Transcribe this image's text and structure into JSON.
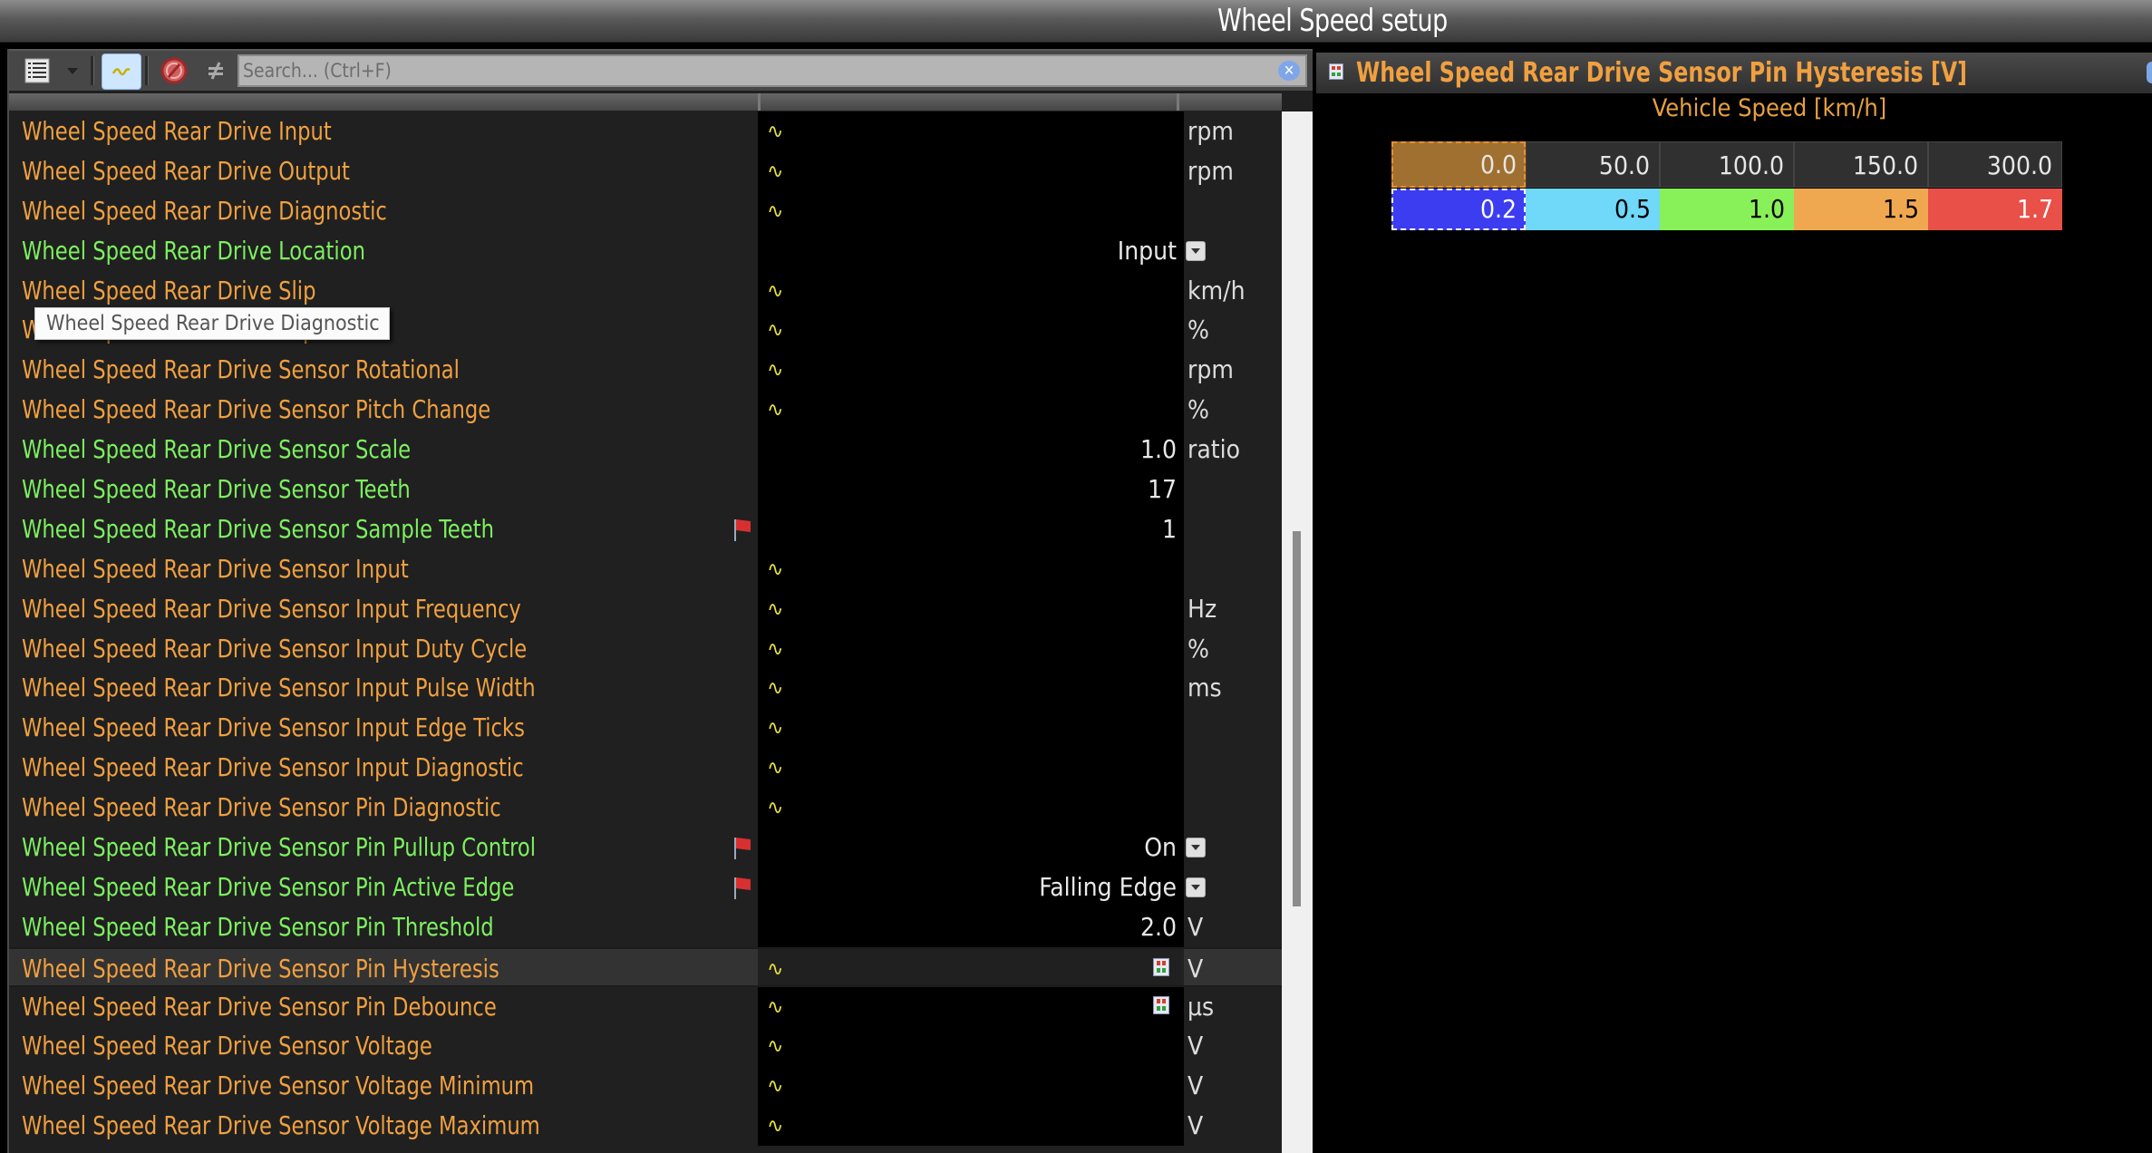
{
  "window": {
    "title": "Wheel Speed setup"
  },
  "toolbar": {
    "view_menu_icon": "list-view-icon",
    "view_dropdown_icon": "chevron-down-icon",
    "live_toggle_icon": "sine-wave-icon",
    "stop_icon": "prohibited-icon",
    "not_equal_icon": "not-equal-icon",
    "search_placeholder": "Search... (Ctrl+F)",
    "search_value": "",
    "clear_icon": "clear-search-icon"
  },
  "tooltip": {
    "text": "Wheel Speed Rear Drive Diagnostic"
  },
  "colors": {
    "output_channel": "#f0a040",
    "setting": "#7df060",
    "live_icon": "#e8e040"
  },
  "channels": [
    {
      "name": "Wheel Speed Rear Drive Input",
      "kind": "output",
      "live": true,
      "value": "",
      "unit": "rpm"
    },
    {
      "name": "Wheel Speed Rear Drive Output",
      "kind": "output",
      "live": true,
      "value": "",
      "unit": "rpm"
    },
    {
      "name": "Wheel Speed Rear Drive Diagnostic",
      "kind": "output",
      "live": true,
      "value": "",
      "unit": ""
    },
    {
      "name": "Wheel Speed Rear Drive Location",
      "kind": "setting",
      "live": false,
      "value": "Input",
      "dropdown": true,
      "unit": ""
    },
    {
      "name": "Wheel Speed Rear Drive Slip",
      "kind": "output",
      "live": true,
      "value": "",
      "unit": "km/h"
    },
    {
      "name": "Wheel Speed Rear Drive Slip Ratio",
      "kind": "output",
      "live": true,
      "value": "",
      "unit": "%"
    },
    {
      "name": "Wheel Speed Rear Drive Sensor Rotational",
      "kind": "output",
      "live": true,
      "value": "",
      "unit": "rpm"
    },
    {
      "name": "Wheel Speed Rear Drive Sensor Pitch Change",
      "kind": "output",
      "live": true,
      "value": "",
      "unit": "%"
    },
    {
      "name": "Wheel Speed Rear Drive Sensor Scale",
      "kind": "setting",
      "live": false,
      "value": "1.0",
      "unit": "ratio"
    },
    {
      "name": "Wheel Speed Rear Drive Sensor Teeth",
      "kind": "setting",
      "live": false,
      "value": "17",
      "unit": ""
    },
    {
      "name": "Wheel Speed Rear Drive Sensor Sample Teeth",
      "kind": "setting",
      "live": false,
      "flag": true,
      "value": "1",
      "unit": ""
    },
    {
      "name": "Wheel Speed Rear Drive Sensor Input",
      "kind": "output",
      "live": true,
      "value": "",
      "unit": ""
    },
    {
      "name": "Wheel Speed Rear Drive Sensor Input Frequency",
      "kind": "output",
      "live": true,
      "value": "",
      "unit": "Hz"
    },
    {
      "name": "Wheel Speed Rear Drive Sensor Input Duty Cycle",
      "kind": "output",
      "live": true,
      "value": "",
      "unit": "%"
    },
    {
      "name": "Wheel Speed Rear Drive Sensor Input Pulse Width",
      "kind": "output",
      "live": true,
      "value": "",
      "unit": "ms"
    },
    {
      "name": "Wheel Speed Rear Drive Sensor Input Edge Ticks",
      "kind": "output",
      "live": true,
      "value": "",
      "unit": ""
    },
    {
      "name": "Wheel Speed Rear Drive Sensor Input Diagnostic",
      "kind": "output",
      "live": true,
      "value": "",
      "unit": ""
    },
    {
      "name": "Wheel Speed Rear Drive Sensor Pin Diagnostic",
      "kind": "output",
      "live": true,
      "value": "",
      "unit": ""
    },
    {
      "name": "Wheel Speed Rear Drive Sensor Pin Pullup Control",
      "kind": "setting",
      "live": false,
      "flag": true,
      "value": "On",
      "dropdown": true,
      "unit": ""
    },
    {
      "name": "Wheel Speed Rear Drive Sensor Pin Active Edge",
      "kind": "setting",
      "live": false,
      "flag": true,
      "value": "Falling Edge",
      "dropdown": true,
      "unit": ""
    },
    {
      "name": "Wheel Speed Rear Drive Sensor Pin Threshold",
      "kind": "setting",
      "live": false,
      "value": "2.0",
      "unit": "V"
    },
    {
      "name": "Wheel Speed Rear Drive Sensor Pin Hysteresis",
      "kind": "output",
      "live": true,
      "table": true,
      "selected": true,
      "value": "",
      "unit": "V"
    },
    {
      "name": "Wheel Speed Rear Drive Sensor Pin Debounce",
      "kind": "output",
      "live": true,
      "table": true,
      "value": "",
      "unit": "µs"
    },
    {
      "name": "Wheel Speed Rear Drive Sensor Voltage",
      "kind": "output",
      "live": true,
      "value": "",
      "unit": "V"
    },
    {
      "name": "Wheel Speed Rear Drive Sensor Voltage Minimum",
      "kind": "output",
      "live": true,
      "value": "",
      "unit": "V"
    },
    {
      "name": "Wheel Speed Rear Drive Sensor Voltage Maximum",
      "kind": "output",
      "live": true,
      "value": "",
      "unit": "V"
    }
  ],
  "scroll": {
    "position_fraction": 0.63,
    "visible_fraction": 0.36
  },
  "table_panel": {
    "title": "Wheel Speed Rear Drive Sensor Pin Hysteresis [V]",
    "title_icon": "table-icon",
    "axis_label": "Vehicle Speed [km/h]",
    "x_axis": [
      "0.0",
      "50.0",
      "100.0",
      "150.0",
      "300.0"
    ],
    "values": [
      "0.2",
      "0.5",
      "1.0",
      "1.5",
      "1.7"
    ],
    "x_axis_color": "#303030",
    "x_axis_selected_color": "#a07030",
    "value_colors": [
      "#3c3cf0",
      "#70d8f8",
      "#88f058",
      "#f0a850",
      "#e85048"
    ],
    "value_text_colors": [
      "#ffffff",
      "#000000",
      "#000000",
      "#000000",
      "#ffffff"
    ],
    "selected_index": 0
  }
}
